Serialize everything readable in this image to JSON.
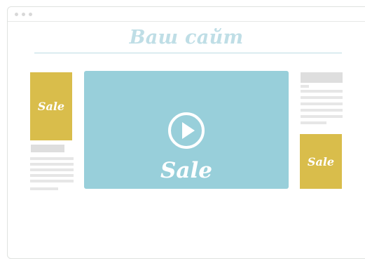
{
  "site": {
    "title": "Ваш сайт"
  },
  "ads": {
    "left_banner_text": "Sale",
    "right_banner_text": "Sale",
    "video_text": "Sale"
  },
  "icons": {
    "play": "play-icon"
  },
  "colors": {
    "title": "#bfdee6",
    "banner": "#d9bd4b",
    "video": "#98cfda",
    "placeholder": "#dedede"
  }
}
